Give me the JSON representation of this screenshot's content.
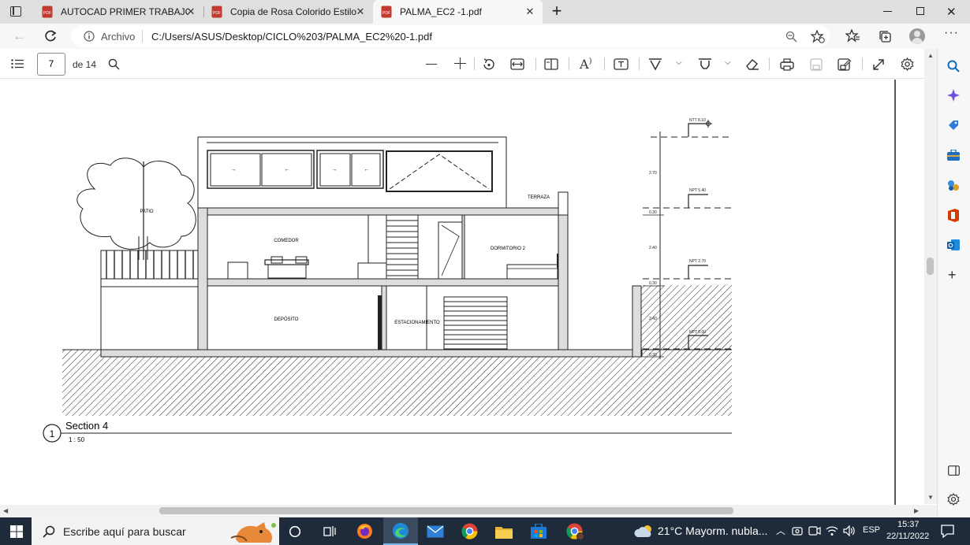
{
  "browser": {
    "tabs": [
      {
        "title": "AUTOCAD PRIMER TRABAJO.pdf"
      },
      {
        "title": "Copia de Rosa Colorido Estilo Se"
      },
      {
        "title": "PALMA_EC2 -1.pdf"
      }
    ],
    "address": {
      "site_label": "Archivo",
      "url": "C:/Users/ASUS/Desktop/CICLO%203/PALMA_EC2%20-1.pdf"
    }
  },
  "pdf_toolbar": {
    "page_number": "7",
    "page_total": "de 14"
  },
  "drawing": {
    "section_number": "1",
    "section_title": "Section 4",
    "scale": "1 : 50",
    "labels": {
      "patio": "PATIO",
      "terraza": "TERRAZA",
      "comedor": "COMEDOR",
      "dormitorio": "DORMITORIO 2",
      "deposito": "DEPÓSITO",
      "estacionamiento": "ESTACIONAMIENTO"
    },
    "levels": [
      "NTT 8.10",
      "NPT 5.40",
      "NPT 2.70",
      "NPT 0.00"
    ],
    "dims": [
      "2.70",
      "0.30",
      "2.40",
      "0.30",
      "2.40",
      "0.30"
    ]
  },
  "taskbar": {
    "search_placeholder": "Escribe aquí para buscar",
    "weather": "21°C  Mayorm. nubla...",
    "language": "ESP",
    "time": "15:37",
    "date": "22/11/2022"
  },
  "colors": {
    "tabstrip": "#dfdfdf",
    "pdf_red": "#c33a32",
    "taskbar": "#1f2b3a",
    "edge_accent": "#0f6cbd"
  }
}
